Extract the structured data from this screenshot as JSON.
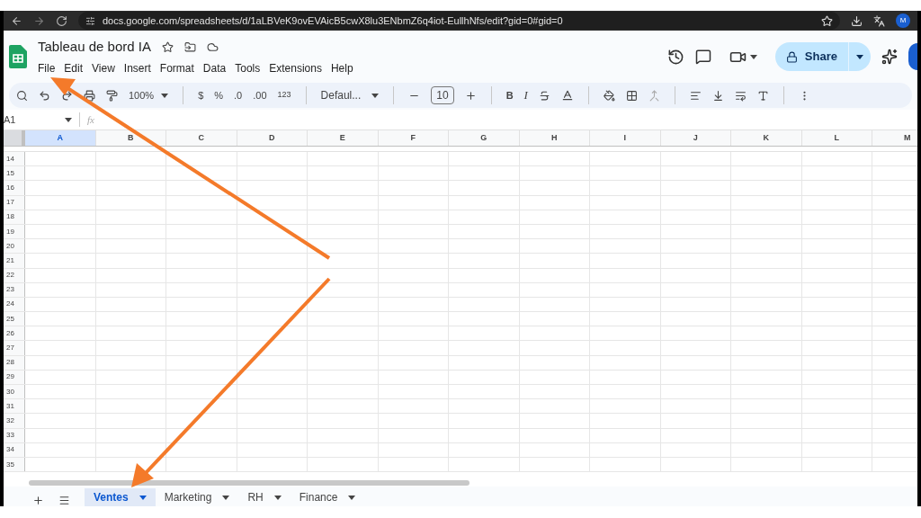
{
  "browser": {
    "url": "docs.google.com/spreadsheets/d/1aLBVeK9ovEVAicB5cwX8lu3ENbmZ6q4iot-EullhNfs/edit?gid=0#gid=0",
    "profile": "M"
  },
  "document": {
    "title": "Tableau de bord IA",
    "menu": [
      "File",
      "Edit",
      "View",
      "Insert",
      "Format",
      "Data",
      "Tools",
      "Extensions",
      "Help"
    ],
    "share": "Share"
  },
  "toolbar": {
    "zoom": "100%",
    "currency": "$",
    "percent": "%",
    "decrease_decimals": ".0",
    "increase_decimals": ".00",
    "number_format": "123",
    "font": "Defaul...",
    "font_size": "10",
    "bold": "B",
    "italic": "I"
  },
  "formula_bar": {
    "cell": "A1",
    "fx": "fx"
  },
  "grid": {
    "columns": [
      {
        "label": "A",
        "selected": true
      },
      {
        "label": "B",
        "selected": false
      },
      {
        "label": "C",
        "selected": false
      },
      {
        "label": "D",
        "selected": false
      },
      {
        "label": "E",
        "selected": false
      },
      {
        "label": "F",
        "selected": false
      },
      {
        "label": "G",
        "selected": false
      },
      {
        "label": "H",
        "selected": false
      },
      {
        "label": "I",
        "selected": false
      },
      {
        "label": "J",
        "selected": false
      },
      {
        "label": "K",
        "selected": false
      },
      {
        "label": "L",
        "selected": false
      },
      {
        "label": "M",
        "selected": false
      }
    ],
    "rows": [
      "14",
      "15",
      "16",
      "17",
      "18",
      "19",
      "20",
      "21",
      "22",
      "23",
      "24",
      "25",
      "26",
      "27",
      "28",
      "29",
      "30",
      "31",
      "32",
      "33",
      "34",
      "35"
    ]
  },
  "sheets": [
    {
      "label": "Ventes",
      "selected": true
    },
    {
      "label": "Marketing",
      "selected": false
    },
    {
      "label": "RH",
      "selected": false
    },
    {
      "label": "Finance",
      "selected": false
    }
  ]
}
